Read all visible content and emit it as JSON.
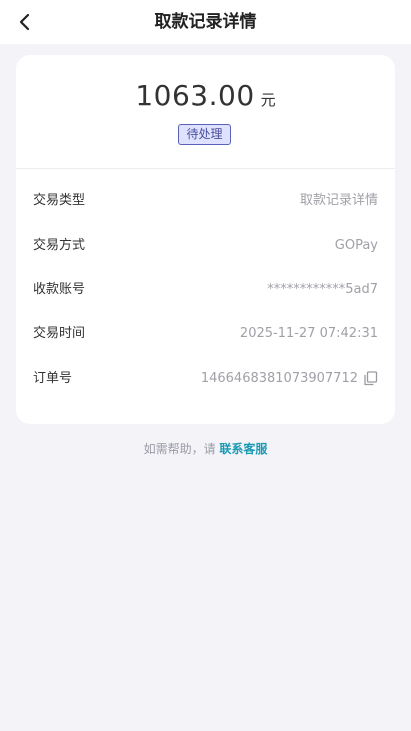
{
  "header": {
    "title": "取款记录详情"
  },
  "summary": {
    "amount": "1063.00",
    "unit": "元",
    "status": "待处理"
  },
  "details": [
    {
      "label": "交易类型",
      "value": "取款记录详情"
    },
    {
      "label": "交易方式",
      "value": "GOPay"
    },
    {
      "label": "收款账号",
      "value": "************5ad7"
    },
    {
      "label": "交易时间",
      "value": "2025-11-27 07:42:31"
    },
    {
      "label": "订单号",
      "value": "1466468381073907712"
    }
  ],
  "help": {
    "prefix": "如需帮助，请",
    "link": "联系客服"
  },
  "icons": {
    "back": "chevron-left-icon",
    "copy": "copy-icon"
  },
  "colors": {
    "background": "#f3f3f8",
    "badge_border": "#5a62b8",
    "badge_fill": "#dfe2ff",
    "link": "#1b9bb3"
  }
}
